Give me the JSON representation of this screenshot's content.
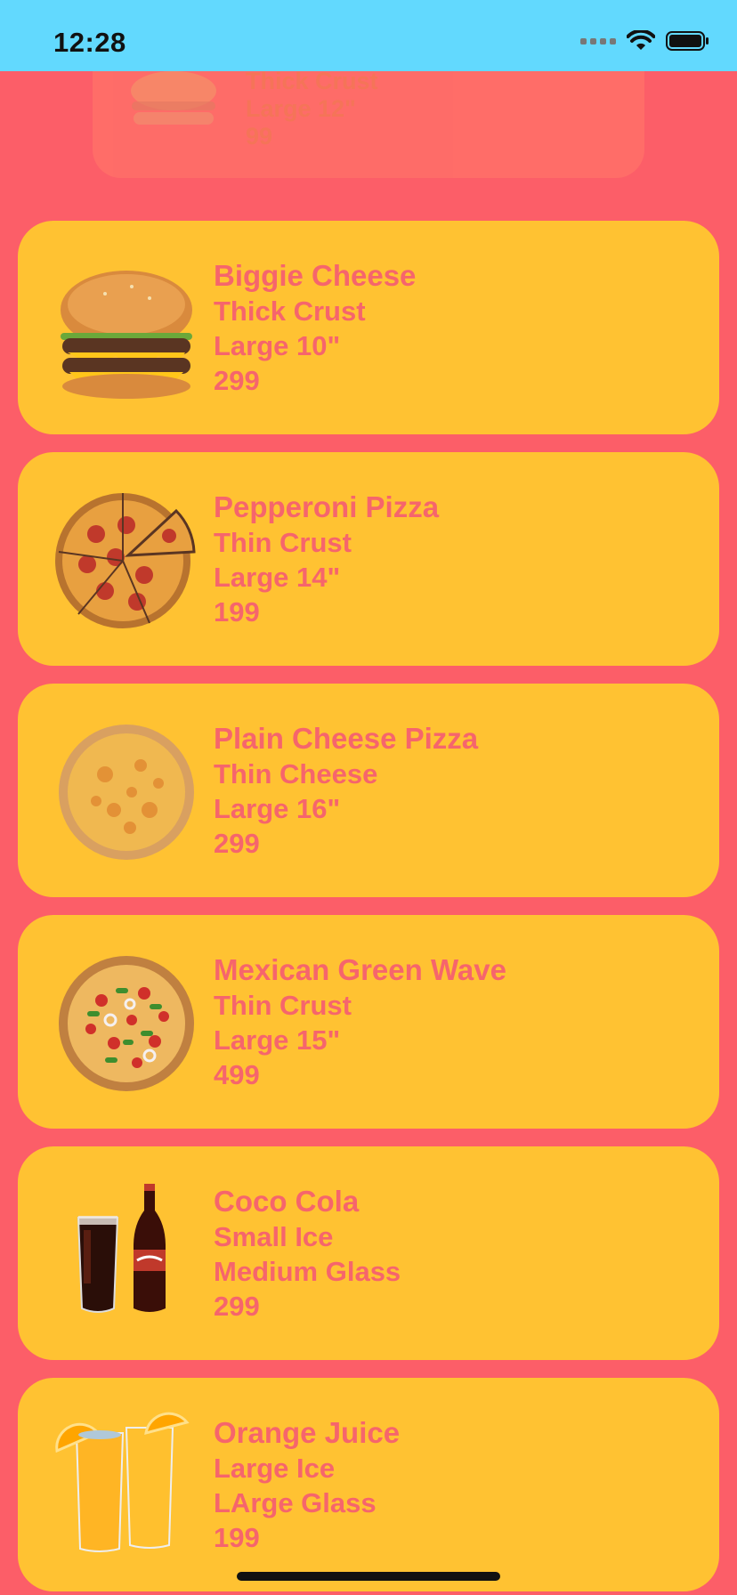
{
  "status_bar": {
    "time": "12:28"
  },
  "faded_card": {
    "line1": "Thick Crust",
    "line2": "Large 12\"",
    "line3": "99"
  },
  "menu_items": [
    {
      "name": "Biggie Cheese",
      "line1": "Thick Crust",
      "line2": "Large 10\"",
      "price": "299",
      "icon": "burger-icon"
    },
    {
      "name": "Pepperoni Pizza",
      "line1": "Thin Crust",
      "line2": "Large 14\"",
      "price": "199",
      "icon": "pepperoni-pizza-icon"
    },
    {
      "name": "Plain Cheese Pizza",
      "line1": "Thin Cheese",
      "line2": "Large 16\"",
      "price": "299",
      "icon": "cheese-pizza-icon"
    },
    {
      "name": "Mexican Green Wave",
      "line1": "Thin Crust",
      "line2": "Large 15\"",
      "price": "499",
      "icon": "veggie-pizza-icon"
    },
    {
      "name": "Coco Cola",
      "line1": "Small Ice",
      "line2": "Medium Glass",
      "price": "299",
      "icon": "cola-icon"
    },
    {
      "name": "Orange Juice",
      "line1": "Large Ice",
      "line2": "LArge Glass",
      "price": "199",
      "icon": "orange-juice-icon"
    }
  ],
  "colors": {
    "background": "#FC5E68",
    "card": "#FFC232",
    "card_text": "#F6656C",
    "status_bar": "#62D9FE"
  }
}
